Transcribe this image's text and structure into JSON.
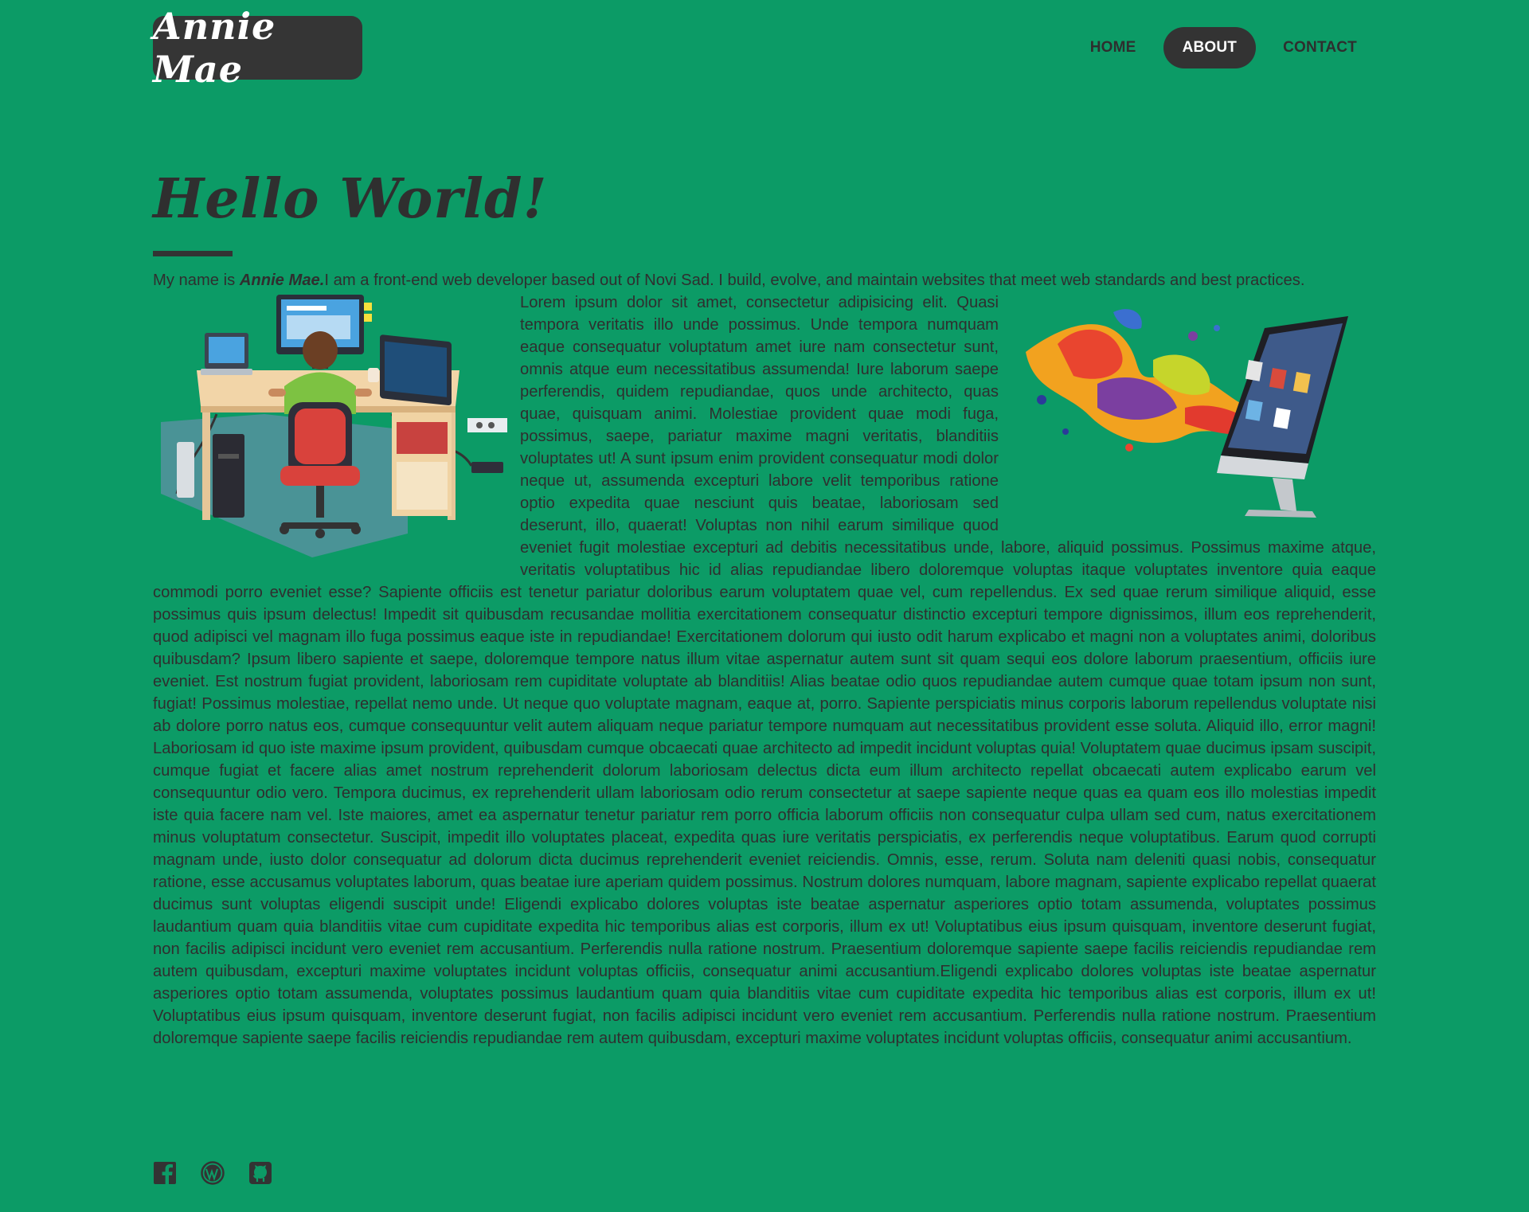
{
  "header": {
    "logo_text": "Annie Mae",
    "nav": [
      {
        "label": "HOME",
        "active": false
      },
      {
        "label": "ABOUT",
        "active": true
      },
      {
        "label": "CONTACT",
        "active": false
      }
    ]
  },
  "main": {
    "title": "Hello World!",
    "intro": {
      "before": "My name is ",
      "name": "Annie Mae.",
      "after": "I am a front-end web developer based out of Novi Sad. I build, evolve, and maintain websites that meet web standards and best practices."
    },
    "paragraph_1": "Lorem ipsum dolor sit amet, consectetur adipisicing elit. Quasi tempora veritatis illo unde possimus. Unde tempora numquam eaque consequatur voluptatum amet iure nam consectetur sunt, omnis atque eum necessitatibus assumenda! Iure laborum saepe perferendis, quidem repudiandae, quos unde architecto, quas quae, quisquam animi. Molestiae provident quae modi fuga, possimus, saepe, pariatur maxime magni veritatis, blanditiis voluptates ut! A sunt ipsum enim provident consequatur modi dolor neque ut, assumenda excepturi labore velit temporibus ratione optio expedita quae nesciunt quis beatae, laboriosam sed deserunt, illo, quaerat! Voluptas non nihil earum similique quod eveniet fugit molestiae excepturi ad debitis necessitatibus unde, labore, aliquid possimus. Possimus maxime atque, veritatis voluptatibus hic id alias repudiandae libero doloremque voluptas itaque voluptates inventore quia eaque commodi porro eveniet esse? Sapiente officiis est tenetur pariatur doloribus earum voluptatem quae vel, cum repellendus. Ex sed quae rerum similique aliquid, esse possimus quis ipsum delectus! Impedit sit quibusdam recusandae mollitia exercitationem consequatur distinctio excepturi tempore dignissimos, illum eos reprehenderit, quod adipisci vel magnam illo fuga possimus eaque iste in repudiandae! Exercitationem dolorum qui iusto odit harum explicabo et magni non a voluptates animi, doloribus quibusdam? Ipsum libero sapiente et saepe, doloremque tempore natus illum vitae aspernatur autem sunt sit quam sequi eos dolore laborum praesentium, officiis iure eveniet. Est nostrum fugiat provident, laboriosam rem cupiditate voluptate ab blanditiis! Alias beatae odio quos repudiandae autem cumque quae totam ipsum non sunt, fugiat! Possimus molestiae, repellat nemo unde. Ut neque quo voluptate magnam, eaque at, porro. Sapiente perspiciatis minus corporis laborum repellendus voluptate nisi ab dolore porro natus eos, cumque consequuntur velit autem aliquam neque pariatur tempore numquam aut necessitatibus provident esse soluta. Aliquid illo, error magni! Laboriosam id quo iste maxime ipsum provident, quibusdam cumque obcaecati quae architecto ad impedit incidunt voluptas quia! Voluptatem quae ducimus ipsam suscipit, cumque fugiat et facere alias amet nostrum reprehenderit dolorum laboriosam delectus dicta eum illum architecto repellat obcaecati autem explicabo earum vel consequuntur odio vero. Tempora ducimus, ex reprehenderit ullam laboriosam odio rerum consectetur at saepe sapiente neque quas ea quam eos illo molestias impedit iste quia facere nam vel. Iste maiores, amet ea aspernatur tenetur pariatur rem porro officia laborum officiis non consequatur culpa ullam sed cum, natus exercitationem minus voluptatum consectetur. Suscipit, impedit illo voluptates placeat, expedita quas iure veritatis perspiciatis, ex perferendis neque voluptatibus. Earum quod corrupti magnam unde, iusto dolor consequatur ad dolorum dicta ducimus reprehenderit eveniet reiciendis. Omnis, esse, rerum. Soluta nam deleniti quasi nobis, consequatur ratione, esse accusamus voluptates laborum, quas beatae iure aperiam quidem possimus. Nostrum dolores numquam, labore magnam, sapiente explicabo repellat quaerat ducimus sunt voluptas eligendi suscipit unde! Eligendi explicabo dolores voluptas iste beatae aspernatur asperiores optio totam assumenda, voluptates possimus laudantium quam quia blanditiis vitae cum cupiditate expedita hic temporibus alias est corporis, illum ex ut! Voluptatibus eius ipsum quisquam, inventore deserunt fugiat, non facilis adipisci incidunt vero eveniet rem accusantium. Perferendis nulla ratione nostrum. Praesentium doloremque sapiente saepe facilis reiciendis repudiandae rem autem quibusdam, excepturi maxime voluptates incidunt voluptas officiis, consequatur animi accusantium.Eligendi explicabo dolores voluptas iste beatae aspernatur asperiores optio totam assumenda, voluptates possimus laudantium quam quia blanditiis vitae cum cupiditate expedita hic temporibus alias est corporis, illum ex ut! Voluptatibus eius ipsum quisquam, inventore deserunt fugiat, non facilis adipisci incidunt vero eveniet rem accusantium. Perferendis nulla ratione nostrum. Praesentium doloremque sapiente saepe facilis reiciendis repudiandae rem autem quibusdam, excepturi maxime voluptates incidunt voluptas officiis, consequatur animi accusantium."
  },
  "social": [
    {
      "icon": "facebook-icon"
    },
    {
      "icon": "wordpress-icon"
    },
    {
      "icon": "github-icon"
    }
  ],
  "colors": {
    "background": "#0c9b66",
    "dark": "#333333",
    "text": "#2f2f2f"
  }
}
